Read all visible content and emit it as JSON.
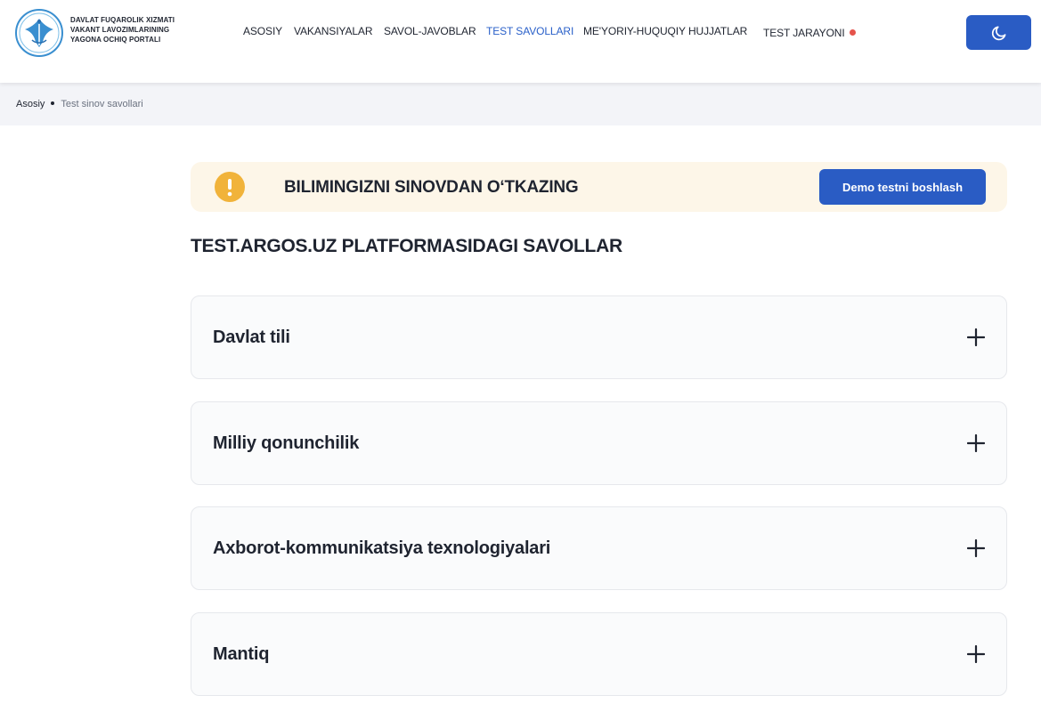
{
  "header": {
    "brand_lines": [
      "DAVLAT FUQAROLIK XIZMATI",
      "VAKANT LAVOZIMLARINING",
      "YAGONA OCHIQ PORTALI"
    ],
    "nav": [
      {
        "label": "ASOSIY",
        "active": false
      },
      {
        "label": "VAKANSIYALAR",
        "active": false
      },
      {
        "label": "SAVOL-JAVOBLAR",
        "active": false
      },
      {
        "label": "TEST SAVOLLARI",
        "active": true
      },
      {
        "label": "ME'YORIY-HUQUQIY HUJJATLAR",
        "active": false
      },
      {
        "label": "TEST JARAYONI",
        "active": false,
        "live_indicator": true
      }
    ],
    "theme_toggle_icon": "moon-icon"
  },
  "breadcrumb": {
    "home": "Asosiy",
    "current": "Test sinov savollari"
  },
  "banner": {
    "icon": "exclamation-icon",
    "text": "BILIMINGIZNI SINOVDAN O‘TKAZING",
    "button_label": "Demo testni boshlash"
  },
  "section_title": "TEST.ARGOS.UZ PLATFORMASIDAGI SAVOLLAR",
  "accordion": [
    {
      "title": "Davlat tili",
      "expanded": false
    },
    {
      "title": "Milliy qonunchilik",
      "expanded": false
    },
    {
      "title": "Axborot-kommunikatsiya texnologiyalari",
      "expanded": false
    },
    {
      "title": "Mantiq",
      "expanded": false
    }
  ],
  "colors": {
    "accent": "#2a5cc4",
    "active_nav": "#2a60c9",
    "banner_bg": "#fdf6e8",
    "warning": "#f1b33a",
    "live_dot": "#e5534b"
  }
}
